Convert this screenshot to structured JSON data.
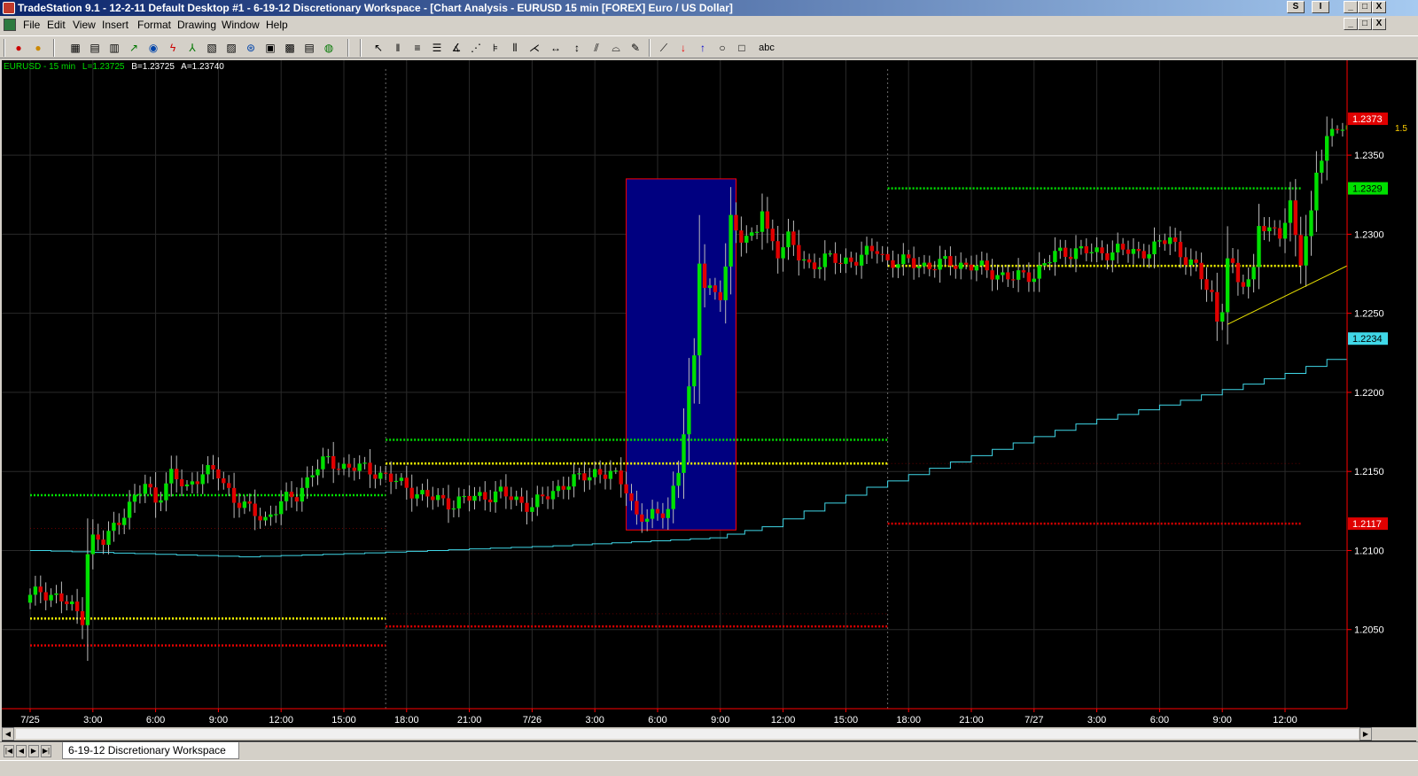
{
  "window": {
    "title": "TradeStation 9.1 - 12-2-11 Default Desktop #1 - 6-19-12 Discretionary Workspace - [Chart Analysis - EURUSD 15 min [FOREX] Euro / US Dollar]",
    "btn_sym": "S",
    "btn_i": "I",
    "minimize": "_",
    "restore": "□",
    "close": "X"
  },
  "menu": [
    "File",
    "Edit",
    "View",
    "Insert",
    "Format",
    "Drawing",
    "Window",
    "Help"
  ],
  "toolbar_text_tool": "abc",
  "workspace_tab": "6-19-12 Discretionary Workspace",
  "nav_buttons": [
    "|◀",
    "◀",
    "▶",
    "▶|"
  ],
  "colors": {
    "background": "#000000",
    "up": "#00e000",
    "down": "#e00000",
    "pivot": "#ffff00",
    "resistance": "#00e000",
    "support": "#e00000",
    "ladder": "#40d8e8",
    "box_fill": "#000080",
    "box_border": "#ff0000",
    "trendline": "#e8e000",
    "price_axis_line": "#ff0000"
  },
  "chart_data": {
    "type": "candlestick",
    "symbol_header": {
      "symbol": "EURUSD - 15 min",
      "last": "L=1.23725",
      "bid": "B=1.23725",
      "ask": "A=1.23740"
    },
    "ylim": [
      1.2,
      1.241
    ],
    "y_ticks": [
      "1.2350",
      "1.2300",
      "1.2250",
      "1.2200",
      "1.2150",
      "1.2100",
      "1.2050"
    ],
    "x_ticks": [
      "7/25",
      "3:00",
      "6:00",
      "9:00",
      "12:00",
      "15:00",
      "18:00",
      "21:00",
      "7/26",
      "3:00",
      "6:00",
      "9:00",
      "12:00",
      "15:00",
      "18:00",
      "21:00",
      "7/27",
      "3:00",
      "6:00",
      "9:00",
      "12:00"
    ],
    "bar_interval": "15 min",
    "session_breaks": [
      "7/25 17:00",
      "7/26 17:00"
    ],
    "price_badges": [
      {
        "label": "1.2373",
        "color": "#e00000",
        "text": "#ffffff"
      },
      {
        "label": "1.2329",
        "color": "#00e000",
        "text": "#000000"
      },
      {
        "label": "1.2234",
        "color": "#40d8e8",
        "text": "#000000"
      },
      {
        "label": "1.2117",
        "color": "#e00000",
        "text": "#ffffff"
      }
    ],
    "last_bar_annotation": "1.5",
    "candles_anchor_close": [
      {
        "t": 0,
        "c": 1.207
      },
      {
        "t": 2,
        "c": 1.2075
      },
      {
        "t": 6,
        "c": 1.2069
      },
      {
        "t": 10,
        "c": 1.2058
      },
      {
        "t": 11,
        "c": 1.21
      },
      {
        "t": 12,
        "c": 1.2107
      },
      {
        "t": 14,
        "c": 1.2105
      },
      {
        "t": 16,
        "c": 1.2115
      },
      {
        "t": 18,
        "c": 1.2125
      },
      {
        "t": 20,
        "c": 1.2132
      },
      {
        "t": 22,
        "c": 1.2142
      },
      {
        "t": 24,
        "c": 1.2132
      },
      {
        "t": 27,
        "c": 1.2147
      },
      {
        "t": 30,
        "c": 1.214
      },
      {
        "t": 33,
        "c": 1.215
      },
      {
        "t": 36,
        "c": 1.2148
      },
      {
        "t": 39,
        "c": 1.2133
      },
      {
        "t": 42,
        "c": 1.2125
      },
      {
        "t": 45,
        "c": 1.212
      },
      {
        "t": 48,
        "c": 1.213
      },
      {
        "t": 51,
        "c": 1.2135
      },
      {
        "t": 54,
        "c": 1.215
      },
      {
        "t": 57,
        "c": 1.2157
      },
      {
        "t": 60,
        "c": 1.2153
      },
      {
        "t": 63,
        "c": 1.2152
      },
      {
        "t": 66,
        "c": 1.215
      },
      {
        "t": 69,
        "c": 1.2145
      },
      {
        "t": 72,
        "c": 1.214
      },
      {
        "t": 75,
        "c": 1.2135
      },
      {
        "t": 78,
        "c": 1.2132
      },
      {
        "t": 81,
        "c": 1.213
      },
      {
        "t": 84,
        "c": 1.2133
      },
      {
        "t": 87,
        "c": 1.2135
      },
      {
        "t": 90,
        "c": 1.2136
      },
      {
        "t": 93,
        "c": 1.2132
      },
      {
        "t": 96,
        "c": 1.2128
      },
      {
        "t": 99,
        "c": 1.2135
      },
      {
        "t": 102,
        "c": 1.2142
      },
      {
        "t": 105,
        "c": 1.2145
      },
      {
        "t": 108,
        "c": 1.215
      },
      {
        "t": 111,
        "c": 1.2148
      },
      {
        "t": 114,
        "c": 1.214
      },
      {
        "t": 116,
        "c": 1.2122
      },
      {
        "t": 118,
        "c": 1.212
      },
      {
        "t": 120,
        "c": 1.2122
      },
      {
        "t": 122,
        "c": 1.2128
      },
      {
        "t": 124,
        "c": 1.215
      },
      {
        "t": 125,
        "c": 1.2175
      },
      {
        "t": 126,
        "c": 1.22
      },
      {
        "t": 127,
        "c": 1.222
      },
      {
        "t": 128,
        "c": 1.2285
      },
      {
        "t": 129,
        "c": 1.227
      },
      {
        "t": 131,
        "c": 1.2262
      },
      {
        "t": 132,
        "c": 1.226
      },
      {
        "t": 133,
        "c": 1.2278
      },
      {
        "t": 134,
        "c": 1.2308
      },
      {
        "t": 136,
        "c": 1.23
      },
      {
        "t": 138,
        "c": 1.2298
      },
      {
        "t": 139,
        "c": 1.2302
      },
      {
        "t": 140,
        "c": 1.2315
      },
      {
        "t": 141,
        "c": 1.23
      },
      {
        "t": 143,
        "c": 1.229
      },
      {
        "t": 145,
        "c": 1.2298
      },
      {
        "t": 147,
        "c": 1.2285
      },
      {
        "t": 149,
        "c": 1.228
      },
      {
        "t": 152,
        "c": 1.2285
      },
      {
        "t": 155,
        "c": 1.2282
      },
      {
        "t": 158,
        "c": 1.2285
      },
      {
        "t": 162,
        "c": 1.229
      },
      {
        "t": 164,
        "c": 1.2283
      },
      {
        "t": 168,
        "c": 1.2282
      },
      {
        "t": 172,
        "c": 1.228
      },
      {
        "t": 176,
        "c": 1.2282
      },
      {
        "t": 180,
        "c": 1.228
      },
      {
        "t": 184,
        "c": 1.2276
      },
      {
        "t": 188,
        "c": 1.2272
      },
      {
        "t": 192,
        "c": 1.2275
      },
      {
        "t": 196,
        "c": 1.2287
      },
      {
        "t": 200,
        "c": 1.229
      },
      {
        "t": 204,
        "c": 1.2288
      },
      {
        "t": 208,
        "c": 1.229
      },
      {
        "t": 212,
        "c": 1.2288
      },
      {
        "t": 216,
        "c": 1.2293
      },
      {
        "t": 218,
        "c": 1.2298
      },
      {
        "t": 220,
        "c": 1.2288
      },
      {
        "t": 222,
        "c": 1.2282
      },
      {
        "t": 224,
        "c": 1.2272
      },
      {
        "t": 226,
        "c": 1.2262
      },
      {
        "t": 227,
        "c": 1.2245
      },
      {
        "t": 228,
        "c": 1.2255
      },
      {
        "t": 229,
        "c": 1.2285
      },
      {
        "t": 231,
        "c": 1.2268
      },
      {
        "t": 233,
        "c": 1.2272
      },
      {
        "t": 234,
        "c": 1.2278
      },
      {
        "t": 235,
        "c": 1.2308
      },
      {
        "t": 237,
        "c": 1.23
      },
      {
        "t": 239,
        "c": 1.23
      },
      {
        "t": 240,
        "c": 1.231
      },
      {
        "t": 241,
        "c": 1.232
      },
      {
        "t": 242,
        "c": 1.23
      },
      {
        "t": 243,
        "c": 1.2283
      },
      {
        "t": 245,
        "c": 1.231
      },
      {
        "t": 246,
        "c": 1.234
      },
      {
        "t": 248,
        "c": 1.2362
      },
      {
        "t": 250,
        "c": 1.2368
      },
      {
        "t": 253,
        "c": 1.2362
      },
      {
        "t": 256,
        "c": 1.2365
      },
      {
        "t": 258,
        "c": 1.236
      },
      {
        "t": 259,
        "c": 1.2354
      },
      {
        "t": 260,
        "c": 1.2373
      }
    ],
    "overlays": {
      "pivot_yellow": [
        {
          "from": "7/25 00:00",
          "to": "7/25 17:00",
          "y": 1.2057
        },
        {
          "from": "7/25 17:00",
          "to": "7/26 17:00",
          "y": 1.2155
        },
        {
          "from": "7/26 17:00",
          "to": "7/27 12:45",
          "y": 1.228
        }
      ],
      "resistance_green": [
        {
          "from": "7/25 00:00",
          "to": "7/25 17:00",
          "y": 1.2135
        },
        {
          "from": "7/25 17:00",
          "to": "7/26 17:00",
          "y": 1.217
        },
        {
          "from": "7/26 17:00",
          "to": "7/27 12:45",
          "y": 1.2329
        }
      ],
      "support_red": [
        {
          "from": "7/25 00:00",
          "to": "7/25 17:00",
          "y": 1.204
        },
        {
          "from": "7/25 17:00",
          "to": "7/26 17:00",
          "y": 1.2052
        },
        {
          "from": "7/26 17:00",
          "to": "7/27 12:45",
          "y": 1.2117
        }
      ],
      "support_red_faint": [
        {
          "from": "7/25 00:00",
          "to": "7/25 17:00",
          "y": 1.2114
        },
        {
          "from": "7/25 17:00",
          "to": "7/26 17:00",
          "y": 1.206
        },
        {
          "from": "7/26 17:00",
          "to": "7/27 12:45",
          "y": 1.2155
        }
      ],
      "ladder_cyan": [
        {
          "t": 0,
          "y": 1.21
        },
        {
          "t": 40,
          "y": 1.2096
        },
        {
          "t": 60,
          "y": 1.2098
        },
        {
          "t": 100,
          "y": 1.2103
        },
        {
          "t": 130,
          "y": 1.2108
        },
        {
          "t": 140,
          "y": 1.2115
        },
        {
          "t": 160,
          "y": 1.214
        },
        {
          "t": 180,
          "y": 1.216
        },
        {
          "t": 200,
          "y": 1.218
        },
        {
          "t": 220,
          "y": 1.2195
        },
        {
          "t": 240,
          "y": 1.2212
        },
        {
          "t": 260,
          "y": 1.2234
        }
      ],
      "highlight_box": {
        "from": "7/26 4:30",
        "to": "7/26 9:45",
        "y_top": 1.2335,
        "y_bottom": 1.2113
      },
      "trendline": {
        "from": {
          "t": 229,
          "y": 1.2243
        },
        "to": {
          "t": 271,
          "y": 1.2311
        }
      }
    }
  }
}
